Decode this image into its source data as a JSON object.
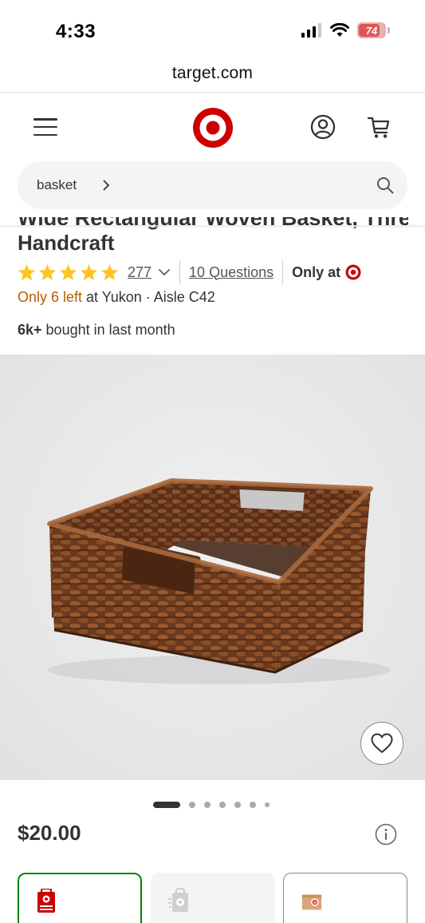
{
  "status_bar": {
    "time": "4:33",
    "battery": "74"
  },
  "browser": {
    "url": "target.com"
  },
  "header": {
    "menu_icon": "hamburger-menu-icon",
    "logo_icon": "target-bullseye-logo",
    "account_icon": "account-icon",
    "cart_icon": "cart-icon",
    "brand_color": "#cc0000"
  },
  "search": {
    "query": "basket"
  },
  "product": {
    "title_partial": "Wide Rectangular Woven Basket, Threshold designed",
    "title_line2": "Handcraft",
    "rating": {
      "stars": 5,
      "review_count": "277"
    },
    "questions_label": "10 Questions",
    "only_at_label": "Only at",
    "stock": {
      "warning": "Only 6 left",
      "location": " at Yukon · Aisle C42"
    },
    "bought": {
      "count": "6k+",
      "text": " bought in last month"
    },
    "image_count": 7,
    "active_image": 1,
    "price": "$20.00"
  },
  "fulfillment": [
    {
      "type": "pickup",
      "icon": "store-pickup-icon",
      "selected": true
    },
    {
      "type": "delivery",
      "icon": "same-day-delivery-icon",
      "selected": false
    },
    {
      "type": "shipping",
      "icon": "shipping-box-icon",
      "selected": false
    }
  ],
  "colors": {
    "warning": "#b85c00",
    "selected_border": "#008300",
    "star": "#ffc420"
  }
}
